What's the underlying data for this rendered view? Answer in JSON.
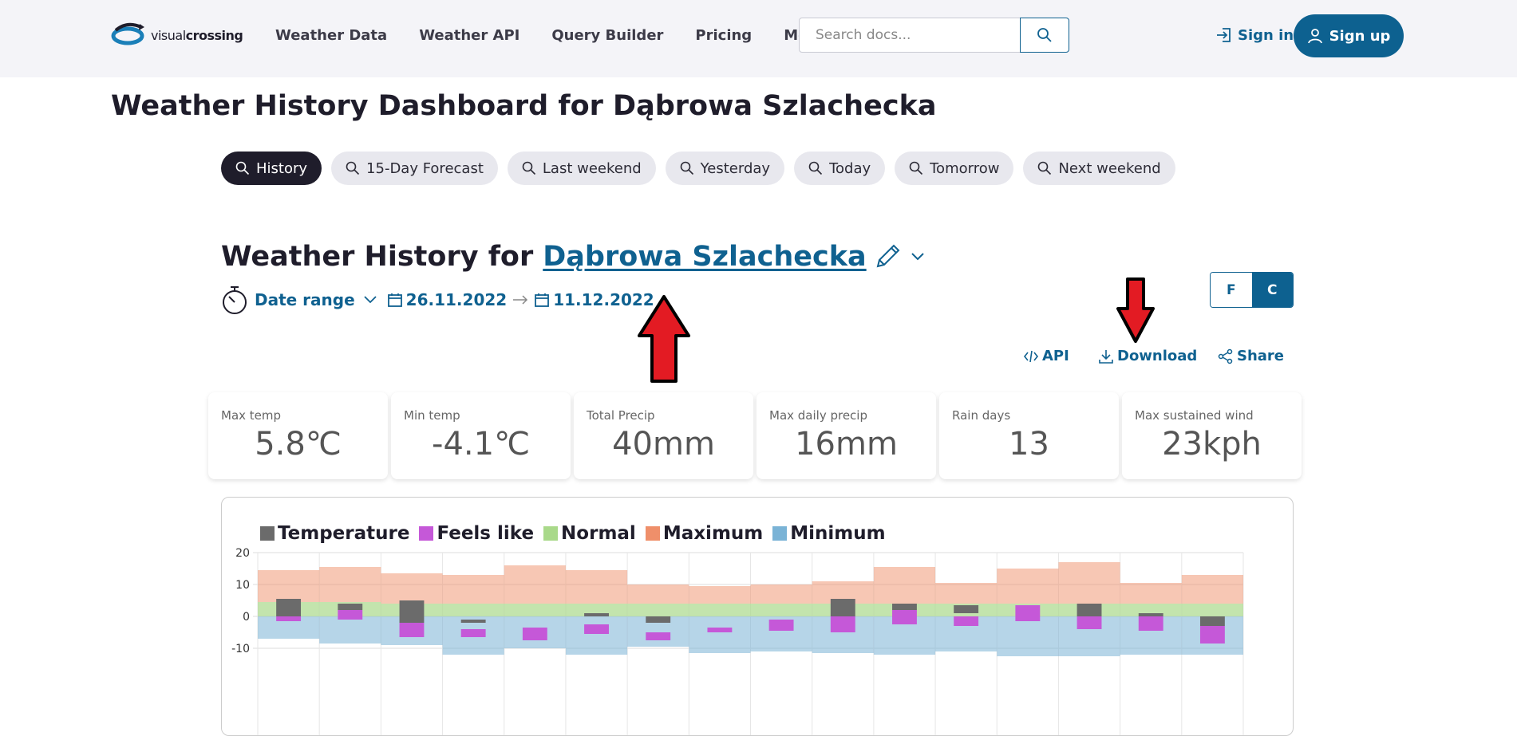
{
  "header": {
    "logo": {
      "text_light": "visual",
      "text_bold": "crossing"
    },
    "nav": [
      {
        "label": "Weather Data"
      },
      {
        "label": "Weather API"
      },
      {
        "label": "Query Builder"
      },
      {
        "label": "Pricing"
      },
      {
        "label": "More"
      }
    ],
    "search_placeholder": "Search docs...",
    "signin_label": "Sign in",
    "signup_label": "Sign up"
  },
  "page_title": "Weather History Dashboard for Dąbrowa Szlachecka",
  "tabs": [
    {
      "label": "History",
      "active": true
    },
    {
      "label": "15-Day Forecast",
      "active": false
    },
    {
      "label": "Last weekend",
      "active": false
    },
    {
      "label": "Yesterday",
      "active": false
    },
    {
      "label": "Today",
      "active": false
    },
    {
      "label": "Tomorrow",
      "active": false
    },
    {
      "label": "Next weekend",
      "active": false
    }
  ],
  "section": {
    "title_prefix": "Weather History for",
    "location": "Dąbrowa Szlachecka",
    "date_range_label": "Date range",
    "start_date": "26.11.2022",
    "end_date": "11.12.2022"
  },
  "units": {
    "f": "F",
    "c": "C",
    "selected": "C"
  },
  "actions": {
    "api": "API",
    "download": "Download",
    "share": "Share"
  },
  "stats": [
    {
      "label": "Max temp",
      "value": "5.8℃"
    },
    {
      "label": "Min temp",
      "value": "-4.1℃"
    },
    {
      "label": "Total Precip",
      "value": "40mm"
    },
    {
      "label": "Max daily precip",
      "value": "16mm"
    },
    {
      "label": "Rain days",
      "value": "13"
    },
    {
      "label": "Max sustained wind",
      "value": "23kph"
    }
  ],
  "colors": {
    "accent": "#0f6190",
    "arrow": "#e31b23",
    "temperature": "#6b6b6b",
    "feelslike": "#c558d8",
    "normal": "#a9d98a",
    "maximum": "#ef8f6a",
    "minimum": "#7ab3d6"
  },
  "chart_data": {
    "type": "bar",
    "legend": [
      "Temperature",
      "Feels like",
      "Normal",
      "Maximum",
      "Minimum"
    ],
    "yticks": [
      20,
      10,
      0,
      -10
    ],
    "ylim": [
      -12,
      21
    ],
    "days": 16,
    "series": [
      {
        "name": "Maximum",
        "values": [
          14.5,
          15.5,
          13.5,
          13.0,
          16.0,
          14.5,
          10.0,
          9.5,
          10.0,
          11.0,
          15.5,
          10.5,
          15.0,
          17.0,
          10.5,
          13.0
        ]
      },
      {
        "name": "Normal",
        "values": [
          4.5,
          4.5,
          4.0,
          4.0,
          4.0,
          4.0,
          4.0,
          4.0,
          4.0,
          4.0,
          4.0,
          4.0,
          4.0,
          4.0,
          4.0,
          4.0
        ]
      },
      {
        "name": "Minimum",
        "values": [
          -7.0,
          -8.5,
          -9.0,
          -12.0,
          -10.0,
          -12.0,
          -9.5,
          -11.5,
          -11.0,
          -11.5,
          -12.0,
          -11.0,
          -12.5,
          -12.5,
          -12.0,
          -12.0
        ]
      },
      {
        "name": "Temperature",
        "range": [
          [
            0,
            5.5
          ],
          [
            2,
            4
          ],
          [
            -2,
            5
          ],
          [
            -2,
            -1
          ],
          [
            0,
            0
          ],
          [
            0,
            1
          ],
          [
            -2,
            0
          ],
          [
            0,
            0
          ],
          [
            0,
            0
          ],
          [
            0,
            5.5
          ],
          [
            2,
            4
          ],
          [
            1,
            3.5
          ],
          [
            0,
            0
          ],
          [
            0,
            4
          ],
          [
            0,
            1
          ],
          [
            -3,
            0
          ]
        ]
      },
      {
        "name": "Feels like",
        "range": [
          [
            -1.5,
            0
          ],
          [
            -1,
            2
          ],
          [
            -6.5,
            -2
          ],
          [
            -6.5,
            -4
          ],
          [
            -7.5,
            -3.5
          ],
          [
            -5.5,
            -2.5
          ],
          [
            -7.5,
            -5
          ],
          [
            -5,
            -3.5
          ],
          [
            -4.5,
            -1
          ],
          [
            -5,
            0
          ],
          [
            -2.5,
            2
          ],
          [
            -3,
            0
          ],
          [
            -1.5,
            3.5
          ],
          [
            -4,
            0
          ],
          [
            -4.5,
            0
          ],
          [
            -8.5,
            -3
          ]
        ]
      }
    ]
  }
}
